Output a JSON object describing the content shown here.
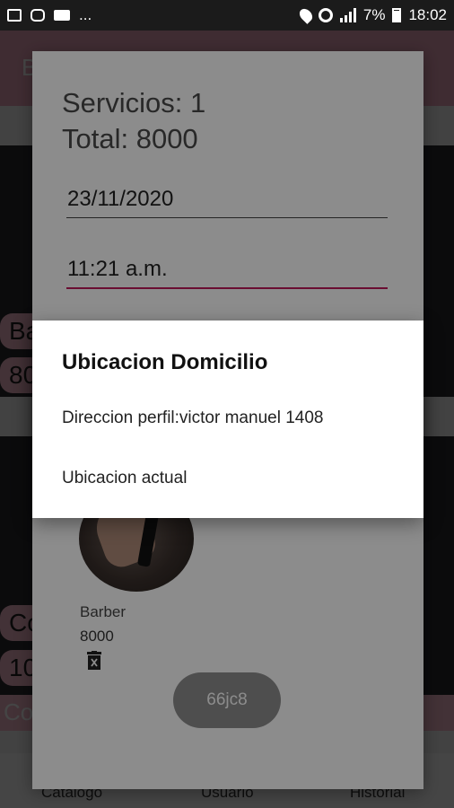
{
  "status_bar": {
    "dots": "...",
    "battery": "7%",
    "time": "18:02"
  },
  "background_app": {
    "appbar_title": "B",
    "chip_1": "Ba",
    "chip_2": "80",
    "chip_3": "Co",
    "chip_4": "10",
    "strip_text": "Co",
    "nav": [
      "Catalogo",
      "Usuario",
      "Historial"
    ]
  },
  "order_dialog": {
    "services_line": "Servicios:  1",
    "total_line": "Total: 8000",
    "date_value": "23/11/2020",
    "time_value": "11:21 a.m.",
    "item_name": "Barber",
    "item_price": "8000",
    "code_label": "66jc8"
  },
  "location_dialog": {
    "title": "Ubicacion Domicilio",
    "options": [
      "Direccion perfil:victor manuel 1408",
      "Ubicacion actual"
    ]
  }
}
